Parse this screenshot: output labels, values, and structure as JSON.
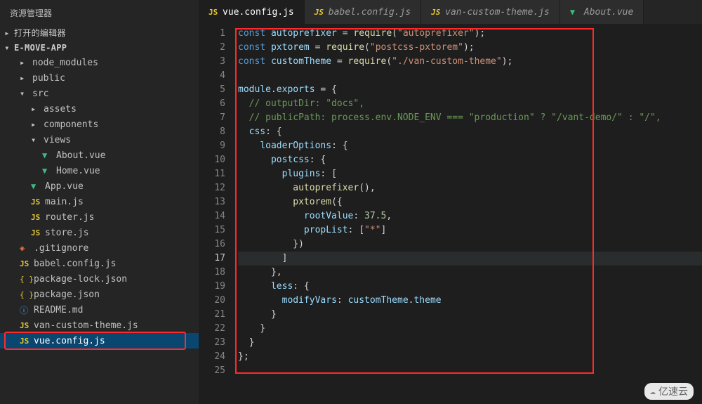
{
  "explorer_title": "资源管理器",
  "sections": {
    "open_editors": "打开的编辑器",
    "project": "E-MOVE-APP"
  },
  "tree": [
    {
      "label": "node_modules",
      "icon": "folder",
      "depth": 1,
      "expanded": false
    },
    {
      "label": "public",
      "icon": "folder",
      "depth": 1,
      "expanded": false
    },
    {
      "label": "src",
      "icon": "folder",
      "depth": 1,
      "expanded": true
    },
    {
      "label": "assets",
      "icon": "folder",
      "depth": 2,
      "expanded": false
    },
    {
      "label": "components",
      "icon": "folder",
      "depth": 2,
      "expanded": false
    },
    {
      "label": "views",
      "icon": "folder",
      "depth": 2,
      "expanded": true
    },
    {
      "label": "About.vue",
      "icon": "vue",
      "depth": 3
    },
    {
      "label": "Home.vue",
      "icon": "vue",
      "depth": 3
    },
    {
      "label": "App.vue",
      "icon": "vue",
      "depth": 2
    },
    {
      "label": "main.js",
      "icon": "js",
      "depth": 2
    },
    {
      "label": "router.js",
      "icon": "js",
      "depth": 2
    },
    {
      "label": "store.js",
      "icon": "js",
      "depth": 2
    },
    {
      "label": ".gitignore",
      "icon": "git",
      "depth": 1
    },
    {
      "label": "babel.config.js",
      "icon": "js",
      "depth": 1
    },
    {
      "label": "package-lock.json",
      "icon": "json",
      "depth": 1
    },
    {
      "label": "package.json",
      "icon": "json",
      "depth": 1
    },
    {
      "label": "README.md",
      "icon": "info",
      "depth": 1
    },
    {
      "label": "van-custom-theme.js",
      "icon": "js",
      "depth": 1
    },
    {
      "label": "vue.config.js",
      "icon": "js",
      "depth": 1,
      "selected": true,
      "highlight": true
    }
  ],
  "tabs": [
    {
      "label": "vue.config.js",
      "icon": "js",
      "active": true
    },
    {
      "label": "babel.config.js",
      "icon": "js"
    },
    {
      "label": "van-custom-theme.js",
      "icon": "js"
    },
    {
      "label": "About.vue",
      "icon": "vue"
    }
  ],
  "current_line": 17,
  "line_count": 25,
  "code": [
    [
      [
        "kw2",
        "const"
      ],
      [
        "pn",
        " "
      ],
      [
        "id",
        "autoprefixer"
      ],
      [
        "pn",
        " "
      ],
      [
        "op",
        "="
      ],
      [
        "pn",
        " "
      ],
      [
        "fn",
        "require"
      ],
      [
        "pn",
        "("
      ],
      [
        "str",
        "\"autoprefixer\""
      ],
      [
        "pn",
        ");"
      ]
    ],
    [
      [
        "kw2",
        "const"
      ],
      [
        "pn",
        " "
      ],
      [
        "id",
        "pxtorem"
      ],
      [
        "pn",
        " "
      ],
      [
        "op",
        "="
      ],
      [
        "pn",
        " "
      ],
      [
        "fn",
        "require"
      ],
      [
        "pn",
        "("
      ],
      [
        "str",
        "\"postcss-pxtorem\""
      ],
      [
        "pn",
        ");"
      ]
    ],
    [
      [
        "kw2",
        "const"
      ],
      [
        "pn",
        " "
      ],
      [
        "id",
        "customTheme"
      ],
      [
        "pn",
        " "
      ],
      [
        "op",
        "="
      ],
      [
        "pn",
        " "
      ],
      [
        "fn",
        "require"
      ],
      [
        "pn",
        "("
      ],
      [
        "str",
        "\"./van-custom-theme\""
      ],
      [
        "pn",
        ");"
      ]
    ],
    [],
    [
      [
        "id",
        "module"
      ],
      [
        "pn",
        "."
      ],
      [
        "prop",
        "exports"
      ],
      [
        "pn",
        " "
      ],
      [
        "op",
        "="
      ],
      [
        "pn",
        " {"
      ]
    ],
    [
      [
        "pn",
        "  "
      ],
      [
        "cm",
        "// outputDir: \"docs\","
      ]
    ],
    [
      [
        "pn",
        "  "
      ],
      [
        "cm",
        "// publicPath: process.env.NODE_ENV === \"production\" ? \"/vant-demo/\" : \"/\","
      ]
    ],
    [
      [
        "pn",
        "  "
      ],
      [
        "prop",
        "css"
      ],
      [
        "pn",
        ": {"
      ]
    ],
    [
      [
        "pn",
        "    "
      ],
      [
        "prop",
        "loaderOptions"
      ],
      [
        "pn",
        ": {"
      ]
    ],
    [
      [
        "pn",
        "      "
      ],
      [
        "prop",
        "postcss"
      ],
      [
        "pn",
        ": {"
      ]
    ],
    [
      [
        "pn",
        "        "
      ],
      [
        "prop",
        "plugins"
      ],
      [
        "pn",
        ": ["
      ]
    ],
    [
      [
        "pn",
        "          "
      ],
      [
        "fn",
        "autoprefixer"
      ],
      [
        "pn",
        "(),"
      ]
    ],
    [
      [
        "pn",
        "          "
      ],
      [
        "fn",
        "pxtorem"
      ],
      [
        "pn",
        "({"
      ]
    ],
    [
      [
        "pn",
        "            "
      ],
      [
        "prop",
        "rootValue"
      ],
      [
        "pn",
        ": "
      ],
      [
        "num",
        "37.5"
      ],
      [
        "pn",
        ","
      ]
    ],
    [
      [
        "pn",
        "            "
      ],
      [
        "prop",
        "propList"
      ],
      [
        "pn",
        ": ["
      ],
      [
        "str",
        "\"*\""
      ],
      [
        "pn",
        "]"
      ]
    ],
    [
      [
        "pn",
        "          })"
      ]
    ],
    [
      [
        "pn",
        "        ]"
      ]
    ],
    [
      [
        "pn",
        "      },"
      ]
    ],
    [
      [
        "pn",
        "      "
      ],
      [
        "prop",
        "less"
      ],
      [
        "pn",
        ": {"
      ]
    ],
    [
      [
        "pn",
        "        "
      ],
      [
        "prop",
        "modifyVars"
      ],
      [
        "pn",
        ": "
      ],
      [
        "id",
        "customTheme"
      ],
      [
        "pn",
        "."
      ],
      [
        "prop",
        "theme"
      ]
    ],
    [
      [
        "pn",
        "      }"
      ]
    ],
    [
      [
        "pn",
        "    }"
      ]
    ],
    [
      [
        "pn",
        "  }"
      ]
    ],
    [
      [
        "pn",
        "};"
      ]
    ],
    []
  ],
  "icons": {
    "chev_right": "▸",
    "chev_down": "▾",
    "js": "JS",
    "vue": "▼",
    "json": "{ }",
    "git": "◈",
    "info": "ⓘ"
  },
  "watermark": "亿速云"
}
